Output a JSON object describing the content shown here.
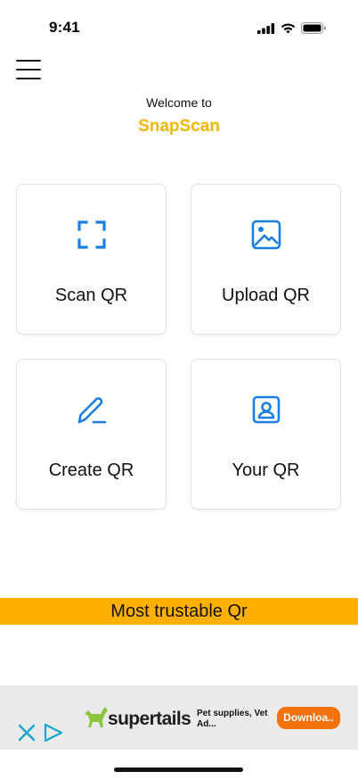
{
  "status_bar": {
    "time": "9:41"
  },
  "header": {
    "welcome_text": "Welcome to",
    "app_name": "SnapScan"
  },
  "cards": [
    {
      "label": "Scan QR",
      "icon": "scan-frame-icon"
    },
    {
      "label": "Upload QR",
      "icon": "image-icon"
    },
    {
      "label": "Create QR",
      "icon": "pencil-icon"
    },
    {
      "label": "Your QR",
      "icon": "profile-card-icon"
    }
  ],
  "banner": {
    "text": "Most trustable Qr"
  },
  "ad": {
    "brand": "supertails",
    "copy": "Pet supplies, Vet Ad...",
    "cta": "Downloa.."
  },
  "colors": {
    "brand_yellow": "#f7b500",
    "banner": "#ffb000",
    "icon_blue": "#1a7fe0",
    "ad_cta": "#f2720f",
    "ad_logo_green": "#8cc63f"
  }
}
